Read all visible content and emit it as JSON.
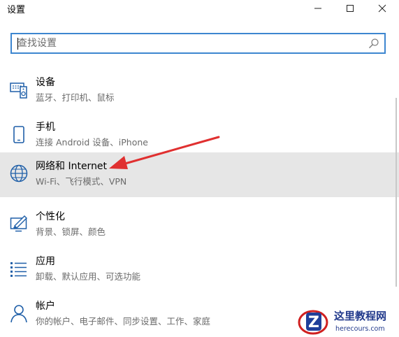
{
  "window": {
    "title": "设置"
  },
  "search": {
    "placeholder": "查找设置",
    "value": ""
  },
  "items": [
    {
      "label": "设备",
      "desc": "蓝牙、打印机、鼠标",
      "icon": "keyboard-speaker-icon"
    },
    {
      "label": "手机",
      "desc": "连接 Android 设备、iPhone",
      "icon": "phone-icon"
    },
    {
      "label": "网络和 Internet",
      "desc": "Wi-Fi、飞行模式、VPN",
      "icon": "globe-icon",
      "selected": true
    },
    {
      "label": "个性化",
      "desc": "背景、锁屏、颜色",
      "icon": "paint-monitor-icon"
    },
    {
      "label": "应用",
      "desc": "卸载、默认应用、可选功能",
      "icon": "app-list-icon"
    },
    {
      "label": "帐户",
      "desc": "你的帐户、电子邮件、同步设置、工作、家庭",
      "icon": "person-icon"
    }
  ],
  "watermark": {
    "text": "这里教程网",
    "sub": "herecours.com"
  },
  "colors": {
    "accent": "#3d86d0",
    "selected_bg": "#e6e6e6",
    "arrow": "#e03030",
    "icon": "#1f5fa8"
  }
}
